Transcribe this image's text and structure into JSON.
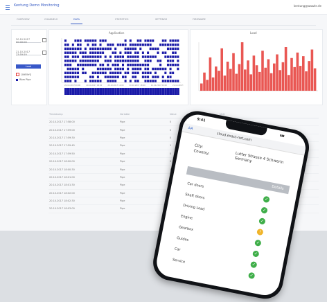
{
  "app": {
    "title": "Kentung Demo Monitoring",
    "account": "kentung@wazzle.de"
  },
  "tabs": [
    {
      "label": "Overview",
      "active": false
    },
    {
      "label": "Channels",
      "active": false
    },
    {
      "label": "Data",
      "active": true
    },
    {
      "label": "Statistics",
      "active": false
    },
    {
      "label": "Settings",
      "active": false
    },
    {
      "label": "Firmware",
      "active": false
    }
  ],
  "filters": {
    "from": "20.10.2017 00:00:00",
    "to": "21.10.2017 23:59:59",
    "load_label": "Load",
    "legend": [
      {
        "label": "Loadavg",
        "color": "#e53935"
      },
      {
        "label": "Rbm Pipe",
        "color": "#1a1aa8"
      }
    ]
  },
  "charts": {
    "left_title": "Application",
    "right_title": "Load"
  },
  "chart_data": [
    {
      "type": "scatter",
      "title": "Application",
      "x": [
        "20.10.2017 00:00",
        "20.10.2017 06:00",
        "20.10.2017 12:00",
        "20.10.2017 18:00",
        "21.10.2017 00:00",
        "21.10.2017 06:00"
      ],
      "series": [
        {
          "color": "#1a1aa8",
          "density": [
            0.9,
            0.85,
            0.95,
            0.7,
            0.9,
            0.8,
            0.6,
            0.95
          ]
        }
      ]
    },
    {
      "type": "bar",
      "title": "Load",
      "series": [
        {
          "color": "#e53935",
          "values": [
            12,
            30,
            18,
            55,
            22,
            40,
            33,
            70,
            25,
            48,
            36,
            62,
            28,
            44,
            80,
            35,
            50,
            27,
            58,
            42,
            31,
            66,
            38,
            52,
            29,
            45,
            60,
            34,
            47,
            72,
            26,
            54,
            39,
            63,
            41,
            57,
            32,
            49,
            68,
            37
          ]
        }
      ]
    }
  ],
  "table": {
    "columns": [
      "Timestamp",
      "Variable",
      "Value",
      "Unit"
    ],
    "rows": [
      [
        "20.10.2017 17:58:00",
        "Pipe",
        "0",
        "%"
      ],
      [
        "20.10.2017 17:59:00",
        "Pipe",
        "0",
        "%"
      ],
      [
        "20.10.2017 17:59:30",
        "Pipe",
        "0",
        "%"
      ],
      [
        "20.10.2017 17:59:45",
        "Pipe",
        "1",
        "%"
      ],
      [
        "20.10.2017 17:59:50",
        "Pipe",
        "0",
        "%"
      ],
      [
        "20.10.2017 18:00:00",
        "Pipe",
        "0",
        "%"
      ],
      [
        "20.10.2017 18:00:30",
        "Pipe",
        "1",
        "%"
      ],
      [
        "20.10.2017 18:01:00",
        "Pipe",
        "0",
        "%"
      ],
      [
        "20.10.2017 18:01:30",
        "Pipe",
        "0",
        "%"
      ],
      [
        "20.10.2017 18:02:00",
        "Pipe",
        "0",
        "%"
      ],
      [
        "20.10.2017 18:02:30",
        "Pipe",
        "0",
        "%"
      ],
      [
        "20.10.2017 18:03:00",
        "Pipe",
        "0",
        "%"
      ]
    ]
  },
  "phone": {
    "time": "9:41",
    "aa": "AA",
    "url": "cloud.exact-net.com",
    "city_label": "City:",
    "country_label": "Country:",
    "city_value": "Lübbecke",
    "address_value": "Lutter Strasse 4  Schwerin Germany",
    "bar_label": "Details",
    "checks": [
      {
        "label": "Car doors",
        "status": "ok"
      },
      {
        "label": "Shaft doors",
        "status": "ok"
      },
      {
        "label": "Driving Load",
        "status": "ok"
      },
      {
        "label": "Engine",
        "status": "warn"
      },
      {
        "label": "Gearbox",
        "status": "ok"
      },
      {
        "label": "Guides",
        "status": "ok"
      },
      {
        "label": "Car",
        "status": "ok"
      },
      {
        "label": "Service",
        "status": "ok"
      }
    ],
    "status_colors": {
      "ok": "#3fae49",
      "warn": "#f0b429"
    }
  }
}
